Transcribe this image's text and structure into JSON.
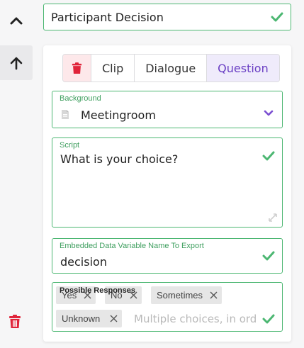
{
  "title_field": {
    "value": "Participant Decision"
  },
  "type_buttons": [
    {
      "label": "Clip",
      "active": false
    },
    {
      "label": "Dialogue",
      "active": false
    },
    {
      "label": "Question",
      "active": true
    }
  ],
  "background": {
    "label": "Background",
    "value": "Meetingroom"
  },
  "script": {
    "label": "Script",
    "value": "What is your choice?"
  },
  "export_var": {
    "label": "Embedded Data Variable Name To Export",
    "value": "decision"
  },
  "responses": {
    "label": "Possible Responses",
    "tags": [
      "Yes",
      "No",
      "Sometimes",
      "Unknown"
    ],
    "placeholder": "Multiple choices, in order"
  },
  "colors": {
    "valid_border": "#4cb772",
    "accent_purple": "#6a3fc4",
    "danger": "#e0243a"
  },
  "icons": [
    "chevron-up-icon",
    "arrow-up-icon",
    "trash-icon",
    "check-icon",
    "file-icon",
    "chevron-down-icon",
    "resize-icon",
    "close-icon"
  ]
}
